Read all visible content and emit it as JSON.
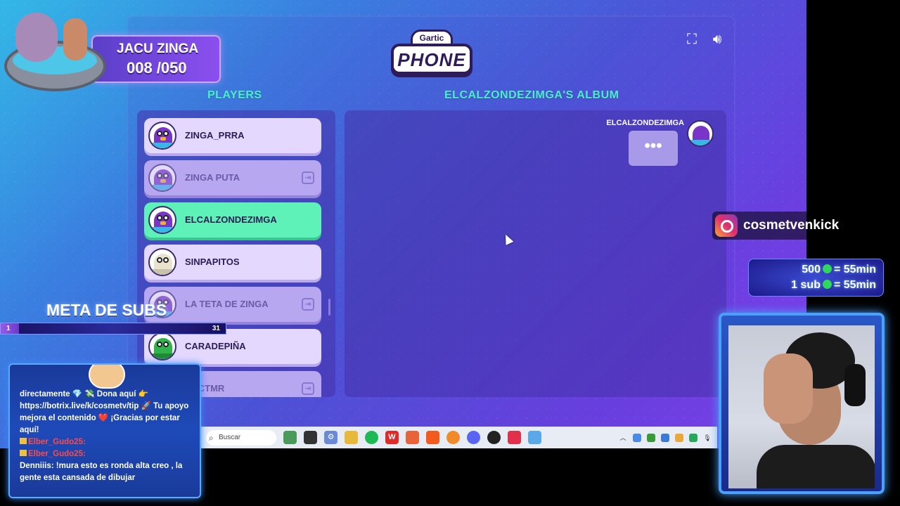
{
  "game": {
    "logo_top": "Gartic",
    "logo_main": "PHONE",
    "players_title": "PLAYERS",
    "album_title": "ELCALZONDEZIMGA'S ALBUM",
    "players": [
      {
        "name": "ZINGA_PRRA",
        "state": "normal",
        "avatar": "purple-bird"
      },
      {
        "name": "ZINGA PUTA",
        "state": "offline",
        "avatar": "purple-bird"
      },
      {
        "name": "ELCALZONDEZIMGA",
        "state": "active",
        "avatar": "purple-bird"
      },
      {
        "name": "SINPAPITOS",
        "state": "normal",
        "avatar": "mummy"
      },
      {
        "name": "LA TETA DE ZINGA",
        "state": "offline",
        "avatar": "purple-bird"
      },
      {
        "name": "CARADEPIÑA",
        "state": "normal",
        "avatar": "green-creature"
      },
      {
        "name": "CACTMR",
        "state": "offline",
        "avatar": "purple-bird"
      }
    ],
    "album": {
      "author": "ELCALZONDEZIMGA",
      "typing_indicator": "•••"
    }
  },
  "taskbar": {
    "search_placeholder": "Buscar"
  },
  "overlay": {
    "badge_name": "JACU ZINGA",
    "badge_count": "008 /050",
    "instagram_handle": "cosmetvenkick",
    "sub_rate_1": "500",
    "sub_rate_1_suffix": "= 55min",
    "sub_rate_2": "1 sub",
    "sub_rate_2_suffix": "= 55min",
    "meta_title": "META DE SUBS",
    "meta_low": "1",
    "meta_high": "31",
    "meta_progress": 0.03
  },
  "chat": {
    "lines": [
      {
        "user": "",
        "text": "directamente 💎 💸 Dona aquí 👉 https://botrix.live/k/cosmetv/tip 🚀 Tu apoyo mejora el contenido ❤️ ¡Gracias por estar aquí!"
      },
      {
        "user": "Elber_Gudo25:",
        "text": ""
      },
      {
        "user": "Elber_Gudo25:",
        "text": ""
      },
      {
        "user": "Denniiis:",
        "text": "!mura esto es ronda alta creo , la gente esta cansada de dibujar"
      }
    ]
  },
  "colors": {
    "accent_title": "#48f0c8",
    "active_player": "#5ff2b8",
    "chat_user": "#ff4a4a"
  }
}
